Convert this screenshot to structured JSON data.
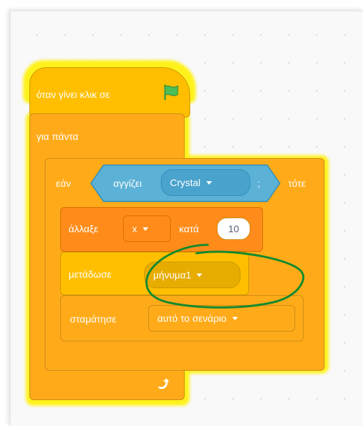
{
  "script": {
    "hat_block": {
      "label": "όταν γίνει κλικ σε",
      "icon": "green-flag-icon"
    },
    "forever_block": {
      "label": "για πάντα",
      "loop_icon": "loop-arrow-icon"
    },
    "if_block": {
      "label_if": "εάν",
      "label_then": "τότε",
      "condition": {
        "label": "αγγίζει",
        "menu_value": "Crystal",
        "separator": ";"
      }
    },
    "change_block": {
      "label": "άλλαξε",
      "menu_value": "x",
      "label_by": "κατά",
      "value": "10"
    },
    "broadcast_block": {
      "label": "μετάδωσε",
      "menu_value": "μήνυμα1"
    },
    "stop_block": {
      "label": "σταμάτησε",
      "menu_value": "αυτό το σενάριο"
    }
  },
  "colors": {
    "control": "#ffab19",
    "events": "#ffbf00",
    "sensing": "#5cb1d6",
    "glow": "#fff21a",
    "annotation": "#138a2e"
  }
}
